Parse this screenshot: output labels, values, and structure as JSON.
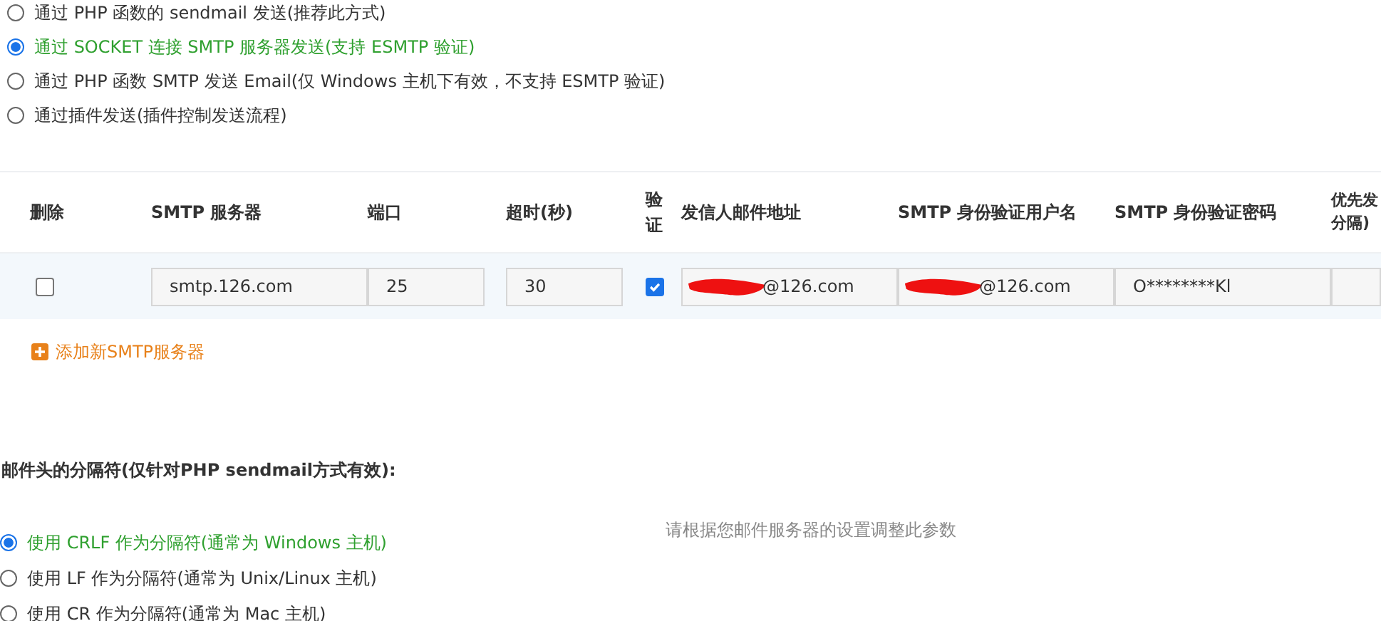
{
  "send_methods": [
    {
      "label": "通过 PHP 函数的 sendmail 发送(推荐此方式)",
      "selected": false
    },
    {
      "label": "通过 SOCKET 连接 SMTP 服务器发送(支持 ESMTP 验证)",
      "selected": true
    },
    {
      "label": "通过 PHP 函数 SMTP 发送 Email(仅 Windows 主机下有效，不支持 ESMTP 验证)",
      "selected": false
    },
    {
      "label": "通过插件发送(插件控制发送流程)",
      "selected": false
    }
  ],
  "smtp_table": {
    "columns": [
      "删除",
      "SMTP 服务器",
      "端口",
      "超时(秒)",
      "验证",
      "发信人邮件地址",
      "SMTP 身份验证用户名",
      "SMTP 身份验证密码",
      "优先发分隔)"
    ],
    "rows": [
      {
        "delete_checked": false,
        "server": "smtp.126.com",
        "port": "25",
        "timeout": "30",
        "auth_checked": true,
        "sender": {
          "value": "@126.com",
          "redacted": true
        },
        "username": {
          "value": "@126.com",
          "redacted": true
        },
        "password": {
          "value": "O********Kl"
        }
      }
    ]
  },
  "add_link": "添加新SMTP服务器",
  "separator": {
    "heading": "邮件头的分隔符(仅针对PHP sendmail方式有效):",
    "options": [
      {
        "label": "使用 CRLF 作为分隔符(通常为 Windows 主机)",
        "selected": true
      },
      {
        "label": "使用 LF 作为分隔符(通常为 Unix/Linux 主机)",
        "selected": false
      },
      {
        "label": "使用 CR 作为分隔符(通常为 Mac 主机)",
        "selected": false
      }
    ],
    "hint": "请根据您邮件服务器的设置调整此参数"
  }
}
